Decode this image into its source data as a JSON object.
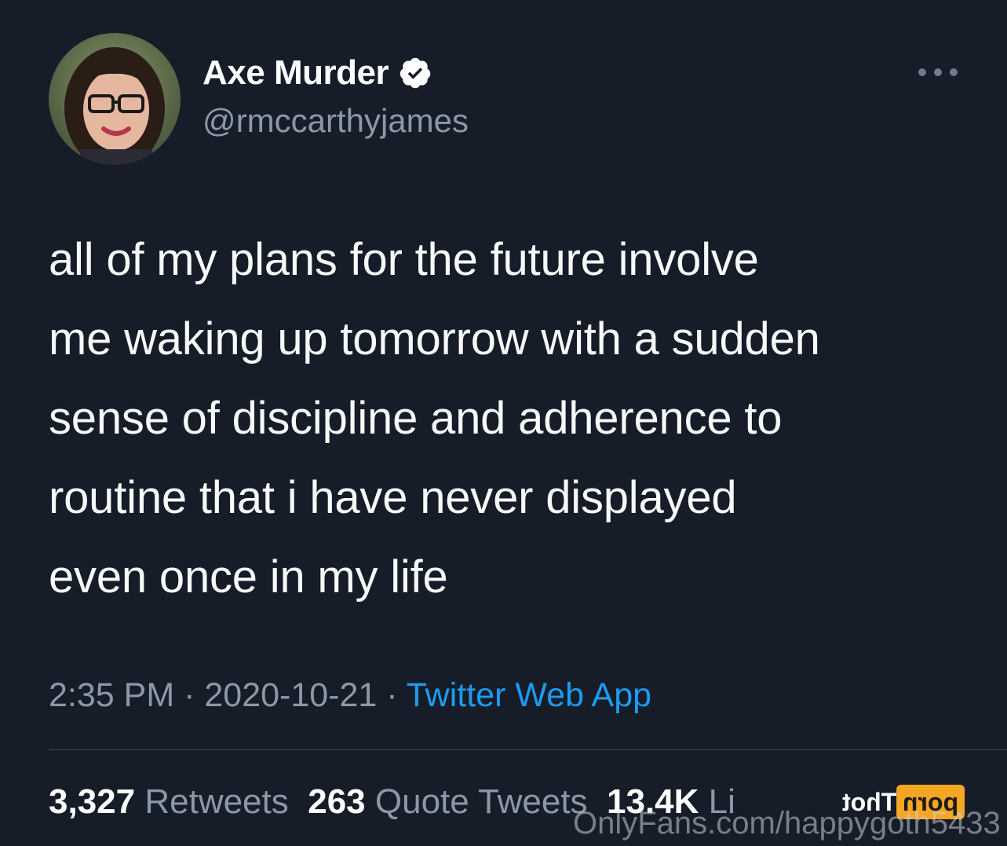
{
  "user": {
    "display_name": "Axe Murder",
    "handle": "@rmccarthyjames",
    "verified": true
  },
  "tweet": {
    "text": "all of my plans for the future involve\nme waking up tomorrow with a sudden\nsense of discipline and adherence to\nroutine that i have never displayed\neven once in my life"
  },
  "meta": {
    "time": "2:35 PM",
    "separator": " · ",
    "date": "2020-10-21",
    "source": "Twitter Web App"
  },
  "stats": {
    "retweets_count": "3,327",
    "retweets_label": "Retweets",
    "quotes_count": "263",
    "quotes_label": "Quote Tweets",
    "likes_count": "13.4K",
    "likes_label": "Li"
  },
  "watermark": {
    "badge_box": "porn",
    "badge_text": "Thot",
    "url": "OnlyFans.com/happygoth5433"
  },
  "icons": {
    "verified": "verified-badge-icon",
    "more": "more-options-icon"
  },
  "colors": {
    "background": "#161d29",
    "link": "#1d9bf0",
    "secondary_text": "#8b98a5",
    "watermark_badge": "#f5a623"
  }
}
